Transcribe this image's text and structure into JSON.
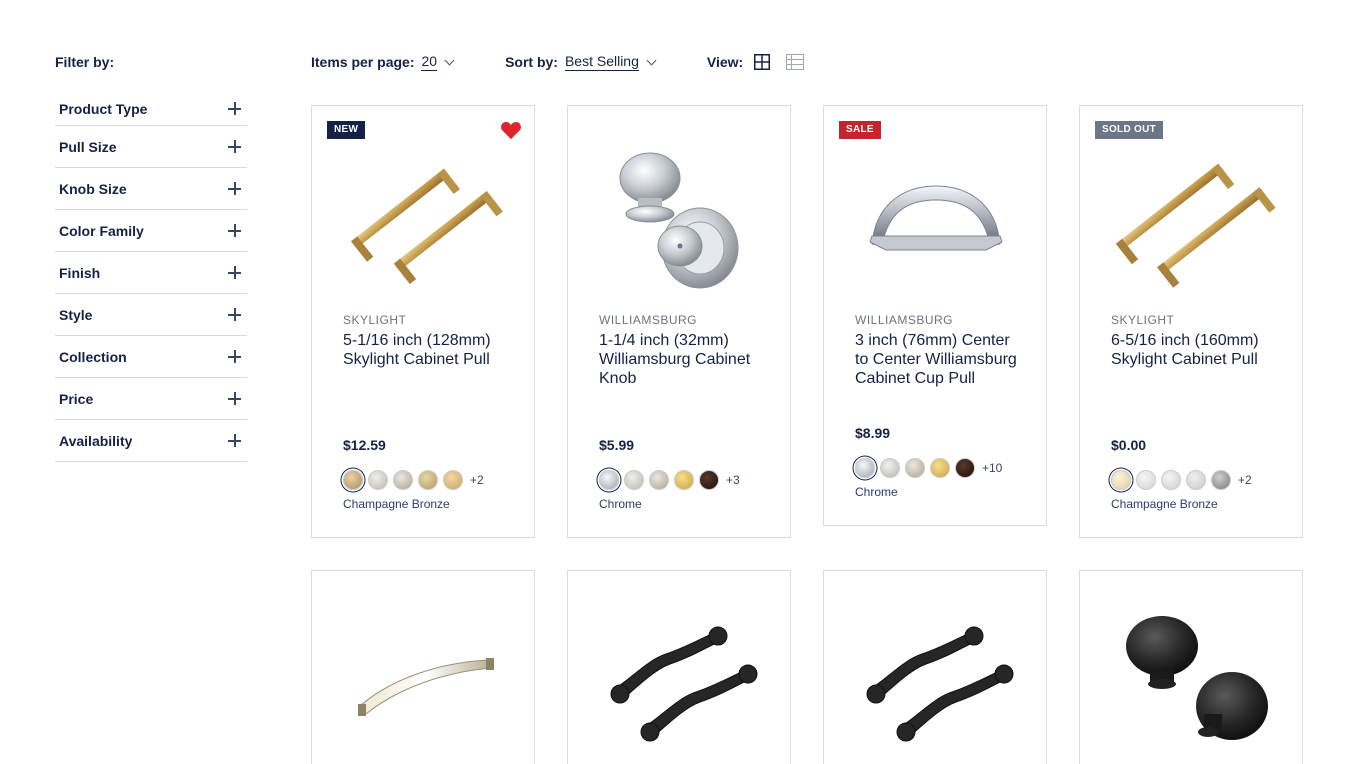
{
  "sidebar": {
    "title": "Filter by:",
    "filters": [
      "Product Type",
      "Pull Size",
      "Knob Size",
      "Color Family",
      "Finish",
      "Style",
      "Collection",
      "Price",
      "Availability"
    ]
  },
  "toolbar": {
    "items_label": "Items per page:",
    "items_value": "20",
    "sort_label": "Sort by:",
    "sort_value": "Best Selling",
    "view_label": "View:"
  },
  "colors": {
    "navy": "#152245",
    "sale_red": "#c0262d",
    "heart_red": "#e0242b",
    "sold_gray": "#6b7787"
  },
  "products": [
    {
      "badge": "NEW",
      "favorite": true,
      "brand": "SKYLIGHT",
      "name": "5-1/16 inch (128mm) Skylight Cabinet Pull",
      "price": "$12.59",
      "more": "+2",
      "finish": "Champagne Bronze",
      "image": "gold-bar-pulls"
    },
    {
      "badge": "",
      "favorite": false,
      "brand": "WILLIAMSBURG",
      "name": "1-1/4 inch (32mm) Williamsburg Cabinet Knob",
      "price": "$5.99",
      "more": "+3",
      "finish": "Chrome",
      "image": "chrome-knobs"
    },
    {
      "badge": "SALE",
      "favorite": false,
      "brand": "WILLIAMSBURG",
      "name": "3 inch (76mm) Center to Center Williamsburg Cabinet Cup Pull",
      "price": "$8.99",
      "more": "+10",
      "finish": "Chrome",
      "image": "chrome-cup-pull"
    },
    {
      "badge": "SOLD OUT",
      "favorite": false,
      "brand": "SKYLIGHT",
      "name": "6-5/16 inch (160mm) Skylight Cabinet Pull",
      "price": "$0.00",
      "more": "+2",
      "finish": "Champagne Bronze",
      "image": "gold-bar-pulls"
    }
  ],
  "row2_images": [
    "arched-nickel-pull",
    "black-iron-pulls",
    "black-iron-pulls",
    "black-hammered-knobs"
  ]
}
